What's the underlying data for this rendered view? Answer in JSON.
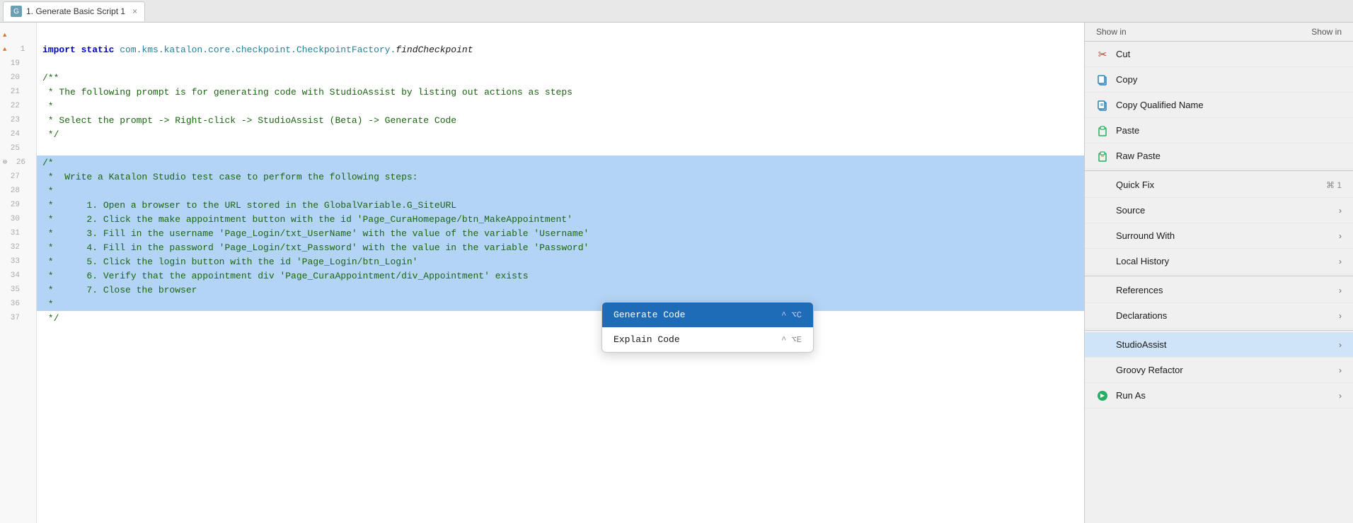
{
  "tab": {
    "icon": "G",
    "label": "1. Generate Basic Script 1",
    "close": "×"
  },
  "editor": {
    "lines": [
      {
        "num": "",
        "marker": "triangle",
        "content": "",
        "parts": [],
        "selected": false
      },
      {
        "num": "1",
        "marker": "triangle",
        "content": "import static com.kms.katalon.core.checkpoint.CheckpointFactory.findCheckpoint",
        "selected": false,
        "type": "import"
      },
      {
        "num": "19",
        "marker": "none",
        "content": "",
        "selected": false
      },
      {
        "num": "20",
        "marker": "none",
        "content": "/**",
        "selected": false,
        "type": "comment"
      },
      {
        "num": "21",
        "marker": "none",
        "content": " * The following prompt is for generating code with StudioAssist by listing out actions as steps",
        "selected": false,
        "type": "comment"
      },
      {
        "num": "22",
        "marker": "none",
        "content": " *",
        "selected": false,
        "type": "comment"
      },
      {
        "num": "23",
        "marker": "none",
        "content": " * Select the prompt -> Right-click -> StudioAssist (Beta) -> Generate Code",
        "selected": false,
        "type": "comment"
      },
      {
        "num": "24",
        "marker": "none",
        "content": " */",
        "selected": false,
        "type": "comment"
      },
      {
        "num": "25",
        "marker": "none",
        "content": "",
        "selected": false
      },
      {
        "num": "26",
        "marker": "collapse",
        "content": "/*",
        "selected": true,
        "type": "comment"
      },
      {
        "num": "27",
        "marker": "none",
        "content": " *  Write a Katalon Studio test case to perform the following steps:",
        "selected": true,
        "type": "comment"
      },
      {
        "num": "28",
        "marker": "none",
        "content": " *",
        "selected": true,
        "type": "comment"
      },
      {
        "num": "29",
        "marker": "none",
        "content": " *      1. Open a browser to the URL stored in the GlobalVariable.G_SiteURL",
        "selected": true,
        "type": "comment"
      },
      {
        "num": "30",
        "marker": "none",
        "content": " *      2. Click the make appointment button with the id 'Page_CuraHomepage/btn_MakeAppointment'",
        "selected": true,
        "type": "comment"
      },
      {
        "num": "31",
        "marker": "none",
        "content": " *      3. Fill in the username 'Page_Login/txt_UserName' with the value of the variable 'Username'",
        "selected": true,
        "type": "comment"
      },
      {
        "num": "32",
        "marker": "none",
        "content": " *      4. Fill in the password 'Page_Login/txt_Password' with the value in the variable 'Password'",
        "selected": true,
        "type": "comment"
      },
      {
        "num": "33",
        "marker": "none",
        "content": " *      5. Click the login button with the id 'Page_Login/btn_Login'",
        "selected": true,
        "type": "comment"
      },
      {
        "num": "34",
        "marker": "none",
        "content": " *      6. Verify that the appointment div 'Page_CuraAppointment/div_Appointment' exists",
        "selected": true,
        "type": "comment"
      },
      {
        "num": "35",
        "marker": "none",
        "content": " *      7. Close the browser",
        "selected": true,
        "type": "comment"
      },
      {
        "num": "36",
        "marker": "none",
        "content": " *",
        "selected": true,
        "type": "comment"
      },
      {
        "num": "37",
        "marker": "none",
        "content": " */",
        "selected": false,
        "type": "comment"
      }
    ]
  },
  "context_menu": {
    "show_in_label": "Show in",
    "show_in_value": "Show in",
    "items": [
      {
        "id": "cut",
        "icon": "✂",
        "icon_type": "scissors",
        "label": "Cut",
        "shortcut": "",
        "hasArrow": false,
        "divider_after": false
      },
      {
        "id": "copy",
        "icon": "⎘",
        "icon_type": "copy",
        "label": "Copy",
        "shortcut": "",
        "hasArrow": false,
        "divider_after": false
      },
      {
        "id": "copy-qualified",
        "icon": "⎘",
        "icon_type": "copy",
        "label": "Copy Qualified Name",
        "shortcut": "",
        "hasArrow": false,
        "divider_after": false
      },
      {
        "id": "paste",
        "icon": "📋",
        "icon_type": "paste",
        "label": "Paste",
        "shortcut": "",
        "hasArrow": false,
        "divider_after": false
      },
      {
        "id": "raw-paste",
        "icon": "📋",
        "icon_type": "paste",
        "label": "Raw Paste",
        "shortcut": "",
        "hasArrow": false,
        "divider_after": true
      },
      {
        "id": "quick-fix",
        "icon": "",
        "icon_type": "none",
        "label": "Quick Fix",
        "shortcut": "⌘ 1",
        "hasArrow": false,
        "divider_after": false
      },
      {
        "id": "source",
        "icon": "",
        "icon_type": "none",
        "label": "Source",
        "shortcut": "",
        "hasArrow": true,
        "divider_after": false
      },
      {
        "id": "surround-with",
        "icon": "",
        "icon_type": "none",
        "label": "Surround With",
        "shortcut": "",
        "hasArrow": true,
        "divider_after": false
      },
      {
        "id": "local-history",
        "icon": "",
        "icon_type": "none",
        "label": "Local History",
        "shortcut": "",
        "hasArrow": true,
        "divider_after": true
      },
      {
        "id": "references",
        "icon": "",
        "icon_type": "none",
        "label": "References",
        "shortcut": "",
        "hasArrow": true,
        "divider_after": false
      },
      {
        "id": "declarations",
        "icon": "",
        "icon_type": "none",
        "label": "Declarations",
        "shortcut": "",
        "hasArrow": true,
        "divider_after": true
      },
      {
        "id": "studio-assist",
        "icon": "",
        "icon_type": "none",
        "label": "StudioAssist",
        "shortcut": "",
        "hasArrow": true,
        "divider_after": false,
        "highlighted": true
      },
      {
        "id": "groovy-refactor",
        "icon": "",
        "icon_type": "none",
        "label": "Groovy Refactor",
        "shortcut": "",
        "hasArrow": true,
        "divider_after": false
      },
      {
        "id": "run-as",
        "icon": "▶",
        "icon_type": "run",
        "label": "Run As",
        "shortcut": "",
        "hasArrow": true,
        "divider_after": false
      }
    ]
  },
  "submenu": {
    "items": [
      {
        "id": "generate-code",
        "label": "Generate Code",
        "shortcut": "^ ⌥C",
        "active": true
      },
      {
        "id": "explain-code",
        "label": "Explain Code",
        "shortcut": "^ ⌥E",
        "active": false
      }
    ]
  }
}
